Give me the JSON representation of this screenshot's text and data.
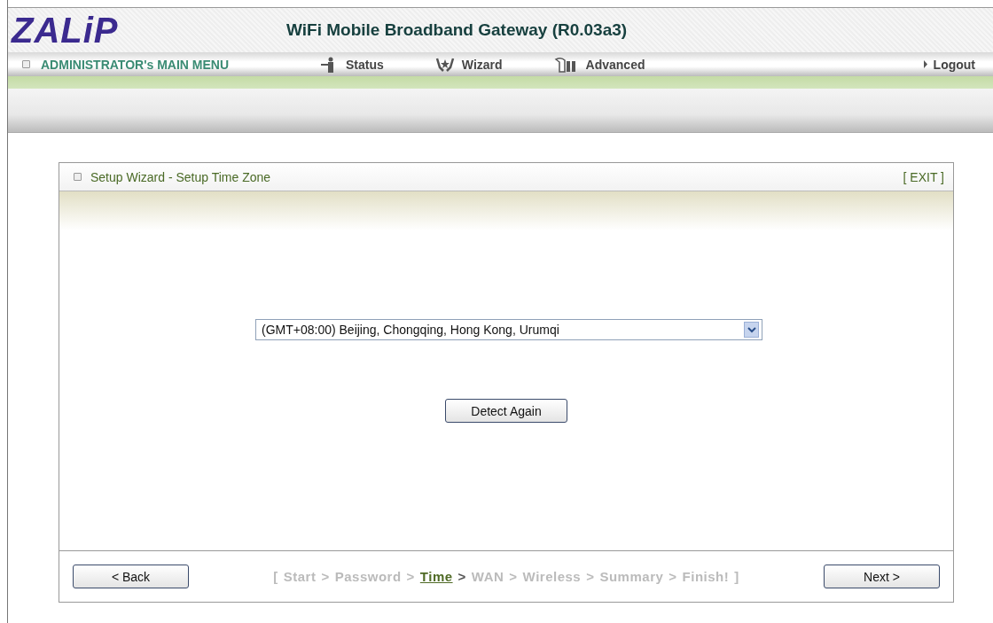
{
  "header": {
    "logo": "ZALiP",
    "title": "WiFi Mobile Broadband Gateway (R0.03a3)"
  },
  "menu": {
    "title": "ADMINISTRATOR's MAIN MENU",
    "items": [
      {
        "label": "Status",
        "kind": "status"
      },
      {
        "label": "Wizard",
        "kind": "wizard"
      },
      {
        "label": "Advanced",
        "kind": "advanced"
      }
    ],
    "logout": "Logout"
  },
  "panel": {
    "title": "Setup Wizard - Setup Time Zone",
    "exit": "[ EXIT ]"
  },
  "timezone": {
    "value": "(GMT+08:00) Beijing, Chongqing, Hong Kong, Urumqi"
  },
  "detect_button": "Detect Again",
  "back_button": "< Back",
  "next_button": "Next >",
  "breadcrumb": {
    "open": "[",
    "close": "]",
    "separator": ">",
    "steps": [
      {
        "label": "Start",
        "selected": false
      },
      {
        "label": "Password",
        "selected": false
      },
      {
        "label": "Time",
        "selected": true
      },
      {
        "label": "WAN",
        "selected": false
      },
      {
        "label": "Wireless",
        "selected": false
      },
      {
        "label": "Summary",
        "selected": false
      },
      {
        "label": "Finish!",
        "selected": false
      }
    ]
  }
}
